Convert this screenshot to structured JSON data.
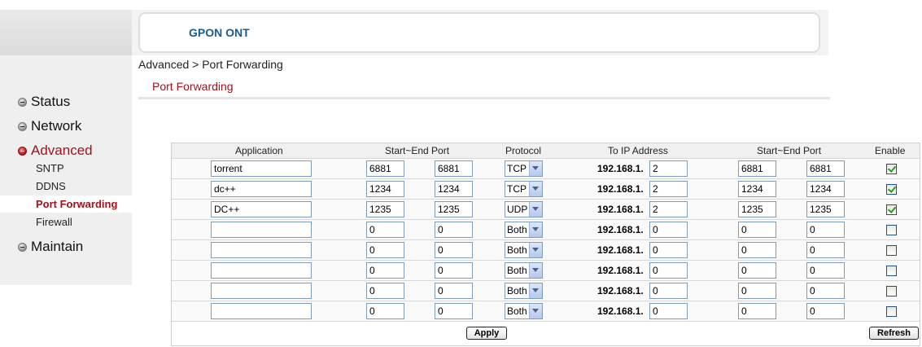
{
  "header": {
    "title": "GPON ONT"
  },
  "breadcrumb": "Advanced > Port Forwarding",
  "page_title": "Port Forwarding",
  "sidebar": {
    "status": "Status",
    "network": "Network",
    "advanced": "Advanced",
    "sub": [
      "SNTP",
      "DDNS",
      "Port Forwarding",
      "Firewall"
    ],
    "maintain": "Maintain"
  },
  "table": {
    "headers": {
      "application": "Application",
      "start_end_port_1": "Start~End Port",
      "protocol": "Protocol",
      "to_ip": "To IP Address",
      "start_end_port_2": "Start~End Port",
      "enable": "Enable"
    },
    "ip_prefix": "192.168.1.",
    "rows": [
      {
        "app": "torrent",
        "ext_start": "6881",
        "ext_end": "6881",
        "protocol": "TCP",
        "ip": "2",
        "int_start": "6881",
        "int_end": "6881",
        "enabled": true
      },
      {
        "app": "dc++",
        "ext_start": "1234",
        "ext_end": "1234",
        "protocol": "TCP",
        "ip": "2",
        "int_start": "1234",
        "int_end": "1234",
        "enabled": true
      },
      {
        "app": "DC++",
        "ext_start": "1235",
        "ext_end": "1235",
        "protocol": "UDP",
        "ip": "2",
        "int_start": "1235",
        "int_end": "1235",
        "enabled": true
      },
      {
        "app": "",
        "ext_start": "0",
        "ext_end": "0",
        "protocol": "Both",
        "ip": "0",
        "int_start": "0",
        "int_end": "0",
        "enabled": false
      },
      {
        "app": "",
        "ext_start": "0",
        "ext_end": "0",
        "protocol": "Both",
        "ip": "0",
        "int_start": "0",
        "int_end": "0",
        "enabled": false
      },
      {
        "app": "",
        "ext_start": "0",
        "ext_end": "0",
        "protocol": "Both",
        "ip": "0",
        "int_start": "0",
        "int_end": "0",
        "enabled": false
      },
      {
        "app": "",
        "ext_start": "0",
        "ext_end": "0",
        "protocol": "Both",
        "ip": "0",
        "int_start": "0",
        "int_end": "0",
        "enabled": false
      },
      {
        "app": "",
        "ext_start": "0",
        "ext_end": "0",
        "protocol": "Both",
        "ip": "0",
        "int_start": "0",
        "int_end": "0",
        "enabled": false
      }
    ]
  },
  "buttons": {
    "apply": "Apply",
    "refresh": "Refresh"
  }
}
